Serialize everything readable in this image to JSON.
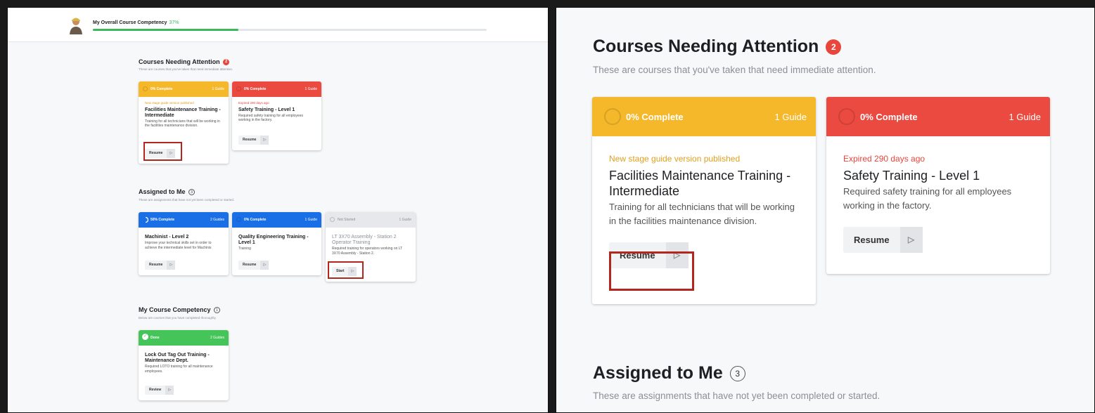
{
  "overall": {
    "title": "My Overall Course Competency",
    "percent_label": "37%",
    "progress": 0.37
  },
  "attention": {
    "title": "Courses Needing Attention",
    "count": "2",
    "description": "These are courses that you've taken that need immediate attention.",
    "cards": [
      {
        "status": "0% Complete",
        "guides": "1 Guide",
        "note": "New stage guide version published",
        "title": "Facilities Maintenance Training - Intermediate",
        "description": "Training for all technicians that will be working in the facilities maintenance division.",
        "button": "Resume",
        "color": "#f5b82a"
      },
      {
        "status": "0% Complete",
        "guides": "1 Guide",
        "note": "Expired 290 days ago",
        "title": "Safety Training - Level 1",
        "description": "Required safety training for all employees working in the factory.",
        "button": "Resume",
        "color": "#ea4a3f"
      }
    ]
  },
  "assigned": {
    "title": "Assigned to Me",
    "count": "3",
    "description": "These are assignments that have not yet been completed or started.",
    "cards": [
      {
        "status": "50% Complete",
        "guides": "2 Guides",
        "title": "Machinist - Level 2",
        "description": "Improve your technical skills set in order to achieve the intermediate level for Machinis",
        "button": "Resume",
        "color": "#1a6fe6"
      },
      {
        "status": "0% Complete",
        "guides": "1 Guide",
        "title": "Quality Engineering Training - Level 1",
        "description": "Training",
        "button": "Resume",
        "color": "#1a6fe6"
      },
      {
        "status": "Not Started",
        "guides": "1 Guide",
        "title": "LT 3X70 Assembly - Station 2 Operator Training",
        "description": "Required training for operators working on LT 3X70 Assembly - Station 2.",
        "button": "Start",
        "color": "#e6e8eb"
      }
    ]
  },
  "competency": {
    "title": "My Course Competency",
    "count": "1",
    "description": "Below are courses that you have completed thoroughly.",
    "cards": [
      {
        "status": "Done",
        "guides": "2 Guides",
        "title": "Lock Out Tag Out Training - Maintenance Dept.",
        "description": "Required LOTO training for all maintenance employees.",
        "button": "Review",
        "color": "#45c45a"
      }
    ]
  },
  "icons": {
    "play": "▷",
    "check": "✓"
  }
}
